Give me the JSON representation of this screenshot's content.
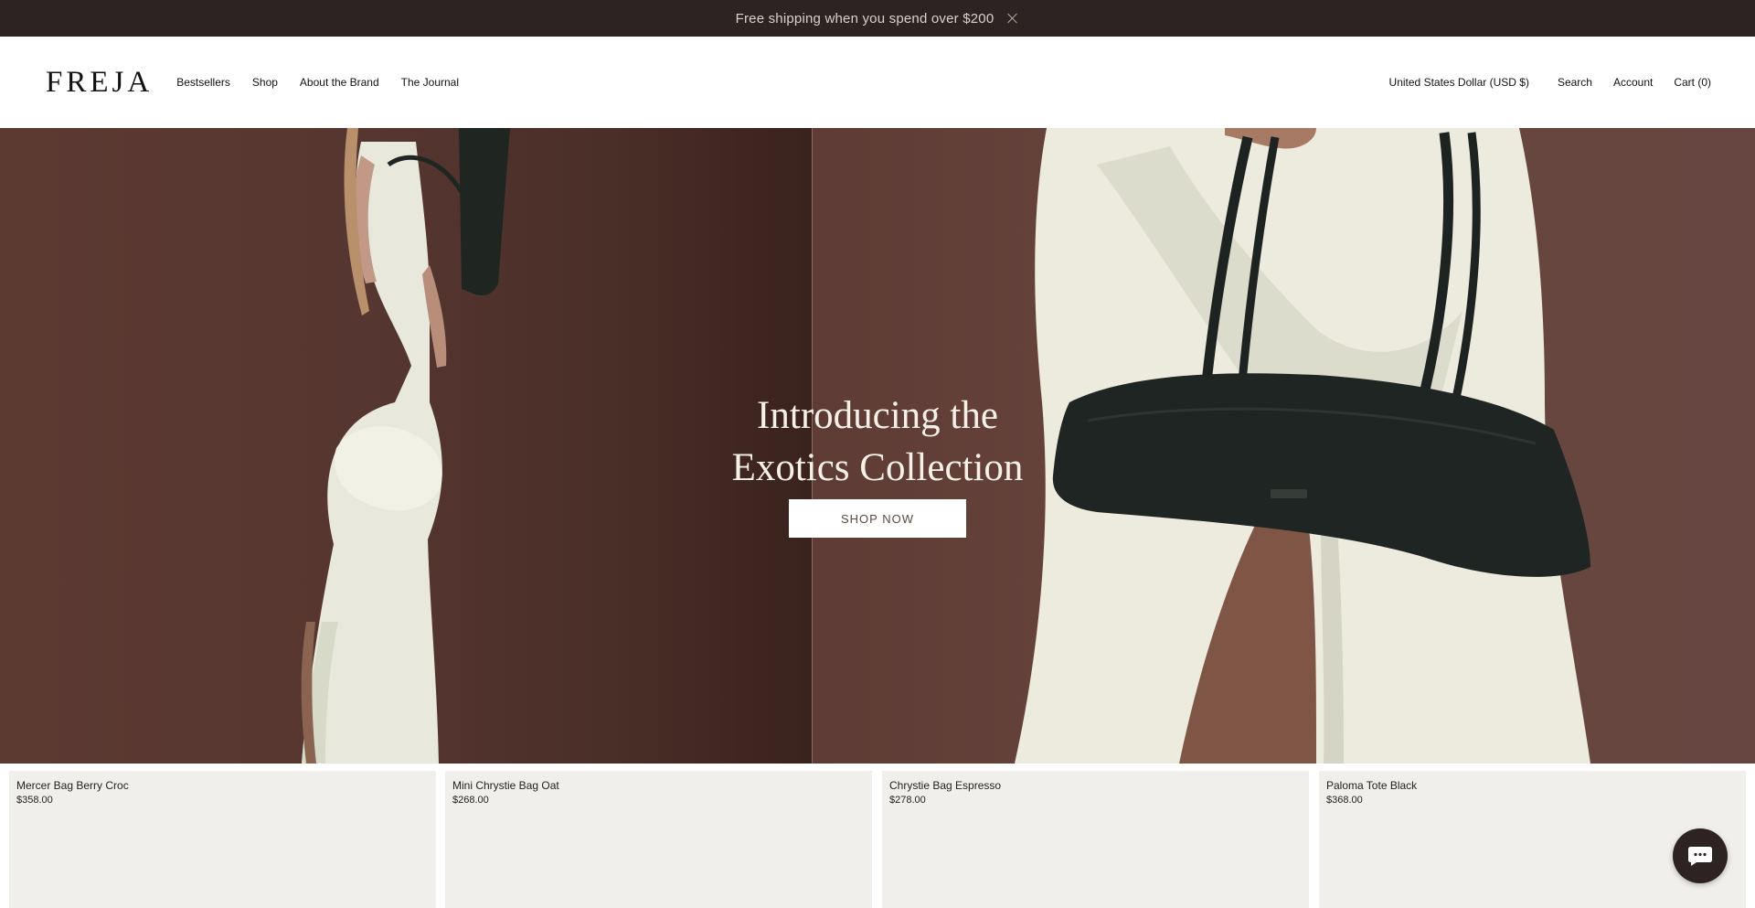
{
  "announcement": {
    "text": "Free shipping when you spend over $200"
  },
  "header": {
    "logo": "FREJA",
    "nav": [
      "Bestsellers",
      "Shop",
      "About the Brand",
      "The Journal"
    ],
    "currency": "United States Dollar (USD $)",
    "search": "Search",
    "account": "Account",
    "cart": "Cart (0)"
  },
  "hero": {
    "title_line1": "Introducing the",
    "title_line2": "Exotics Collection",
    "cta": "SHOP NOW"
  },
  "products": [
    {
      "name": "Mercer Bag Berry Croc",
      "price": "$358.00"
    },
    {
      "name": "Mini Chrystie Bag Oat",
      "price": "$268.00"
    },
    {
      "name": "Chrystie Bag Espresso",
      "price": "$278.00"
    },
    {
      "name": "Paloma Tote Black",
      "price": "$368.00"
    }
  ],
  "colors": {
    "announcement_bg": "#2e2323",
    "hero_bg": "#5e3c35",
    "card_bg": "#f0efeb",
    "chat_button": "#2e2323"
  },
  "icons": {
    "close": "close-icon",
    "chat": "chat-icon"
  }
}
